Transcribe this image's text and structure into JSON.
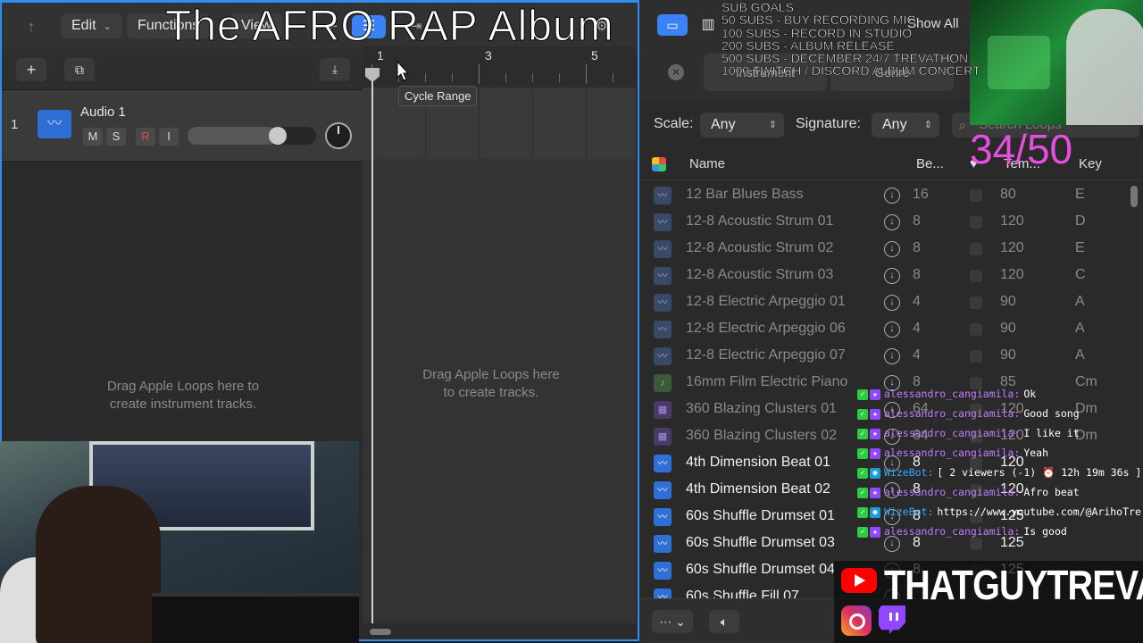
{
  "overlay": {
    "title": "The AFRO RAP Album",
    "sub_goals": [
      "SUB GOALS",
      "50 SUBS - BUY RECORDING MIC",
      "100 SUBS - RECORD IN STUDIO",
      "200 SUBS - ALBUM RELEASE",
      "500 SUBS - DECEMBER 24/7 TREVATHON",
      "1000 TWITCH / DISCORD ALBUM CONCERT"
    ],
    "sub_count": "34/50",
    "brand_name": "THATGUYTREVA"
  },
  "toolbar": {
    "edit_label": "Edit",
    "functions_label": "Functions",
    "view_label": "View"
  },
  "track": {
    "number": "1",
    "name": "Audio 1",
    "mute": "M",
    "solo": "S",
    "record": "R",
    "input": "I",
    "volume_level": 0.7
  },
  "arrange": {
    "ruler_numbers": [
      "1",
      "3",
      "5"
    ],
    "tooltip": "Cycle Range",
    "drag_instruction_left": "Drag Apple Loops here to create instrument tracks.",
    "drag_instruction_right": "Drag Apple Loops here to create tracks."
  },
  "browser": {
    "show_all": "Show All",
    "tabs": [
      "Instrument",
      "Genre"
    ],
    "scale_label": "Scale:",
    "scale_value": "Any",
    "signature_label": "Signature:",
    "signature_value": "Any",
    "search_placeholder": "Search Loops",
    "columns": {
      "name": "Name",
      "beats": "Be...",
      "tempo": "Tem...",
      "key": "Key"
    },
    "loops": [
      {
        "name": "12 Bar Blues Bass",
        "beats": "16",
        "tempo": "80",
        "key": "E",
        "type": "audio",
        "style": "dim"
      },
      {
        "name": "12-8 Acoustic Strum 01",
        "beats": "8",
        "tempo": "120",
        "key": "D",
        "type": "audio",
        "style": "dim"
      },
      {
        "name": "12-8 Acoustic Strum 02",
        "beats": "8",
        "tempo": "120",
        "key": "E",
        "type": "audio",
        "style": "dim"
      },
      {
        "name": "12-8 Acoustic Strum 03",
        "beats": "8",
        "tempo": "120",
        "key": "C",
        "type": "audio",
        "style": "dim"
      },
      {
        "name": "12-8 Electric Arpeggio 01",
        "beats": "4",
        "tempo": "90",
        "key": "A",
        "type": "audio",
        "style": "dim"
      },
      {
        "name": "12-8 Electric Arpeggio 06",
        "beats": "4",
        "tempo": "90",
        "key": "A",
        "type": "audio",
        "style": "dim"
      },
      {
        "name": "12-8 Electric Arpeggio 07",
        "beats": "4",
        "tempo": "90",
        "key": "A",
        "type": "audio",
        "style": "dim"
      },
      {
        "name": "16mm Film Electric Piano",
        "beats": "8",
        "tempo": "85",
        "key": "Cm",
        "type": "green",
        "style": "dim"
      },
      {
        "name": "360 Blazing Clusters 01",
        "beats": "64",
        "tempo": "120",
        "key": "Dm",
        "type": "purple",
        "style": "dim"
      },
      {
        "name": "360 Blazing Clusters 02",
        "beats": "64",
        "tempo": "120",
        "key": "Dm",
        "type": "purple",
        "style": "dim"
      },
      {
        "name": "4th Dimension Beat 01",
        "beats": "8",
        "tempo": "120",
        "key": "",
        "type": "audio",
        "style": "bright"
      },
      {
        "name": "4th Dimension Beat 02",
        "beats": "8",
        "tempo": "120",
        "key": "",
        "type": "audio",
        "style": "bright"
      },
      {
        "name": "60s Shuffle Drumset 01",
        "beats": "8",
        "tempo": "125",
        "key": "",
        "type": "audio",
        "style": "bright"
      },
      {
        "name": "60s Shuffle Drumset 03",
        "beats": "8",
        "tempo": "125",
        "key": "",
        "type": "audio",
        "style": "bright"
      },
      {
        "name": "60s Shuffle Drumset 04",
        "beats": "8",
        "tempo": "125",
        "key": "",
        "type": "audio",
        "style": "bright"
      },
      {
        "name": "60s Shuffle Fill 07",
        "beats": "",
        "tempo": "",
        "key": "",
        "type": "audio",
        "style": "bright"
      }
    ]
  },
  "chat": [
    {
      "user": "alessandro_cangiamila:",
      "msg": "Ok",
      "bot": false
    },
    {
      "user": "alessandro_cangiamila:",
      "msg": "Good song",
      "bot": false
    },
    {
      "user": "alessandro_cangiamila:",
      "msg": "I like it",
      "bot": false
    },
    {
      "user": "alessandro_cangiamila:",
      "msg": "Yeah",
      "bot": false
    },
    {
      "user": "WizeBot:",
      "msg": "[ 2 viewers (-1) ⏰ 12h 19m 36s ]",
      "bot": true
    },
    {
      "user": "alessandro_cangiamila:",
      "msg": "Afro beat",
      "bot": false
    },
    {
      "user": "WizeBot:",
      "msg": "https://www.youtube.com/@ArihoTre",
      "bot": true
    },
    {
      "user": "alessandro_cangiamila:",
      "msg": "Is good",
      "bot": false
    }
  ]
}
